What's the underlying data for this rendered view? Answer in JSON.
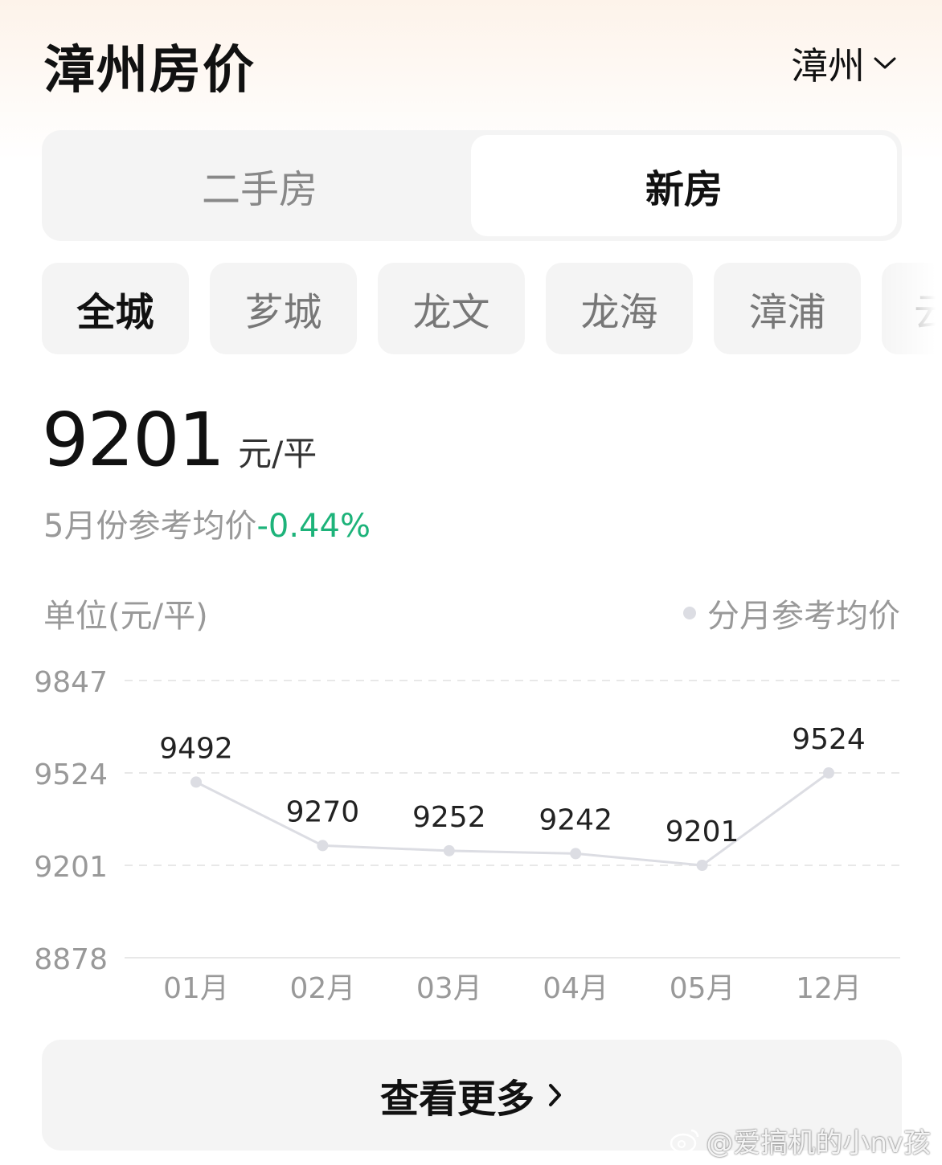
{
  "header": {
    "title": "漳州房价",
    "city": "漳州"
  },
  "segment": {
    "left_label": "二手房",
    "right_label": "新房",
    "selected": "新房"
  },
  "districts": [
    {
      "label": "全城",
      "active": true
    },
    {
      "label": "芗城",
      "active": false
    },
    {
      "label": "龙文",
      "active": false
    },
    {
      "label": "龙海",
      "active": false
    },
    {
      "label": "漳浦",
      "active": false
    },
    {
      "label": "云",
      "active": false
    }
  ],
  "price": {
    "value": "9201",
    "unit": "元/平"
  },
  "reference": {
    "text": "5月份参考均价",
    "change": "-0.44%",
    "change_color": "#1db37a"
  },
  "chart_header": {
    "unit_label": "单位(元/平)",
    "legend_label": "分月参考均价"
  },
  "chart_data": {
    "type": "line",
    "categories": [
      "01月",
      "02月",
      "03月",
      "04月",
      "05月",
      "12月"
    ],
    "series": [
      {
        "name": "分月参考均价",
        "values": [
          9492,
          9270,
          9252,
          9242,
          9201,
          9524
        ]
      }
    ],
    "y_ticks": [
      9847,
      9524,
      9201,
      8878
    ],
    "ylim": [
      8878,
      9847
    ],
    "grid": true,
    "line_color": "#dcdde3"
  },
  "more_button": {
    "label": "查看更多"
  },
  "watermark": {
    "text": "@爱搞机的小nv孩"
  }
}
